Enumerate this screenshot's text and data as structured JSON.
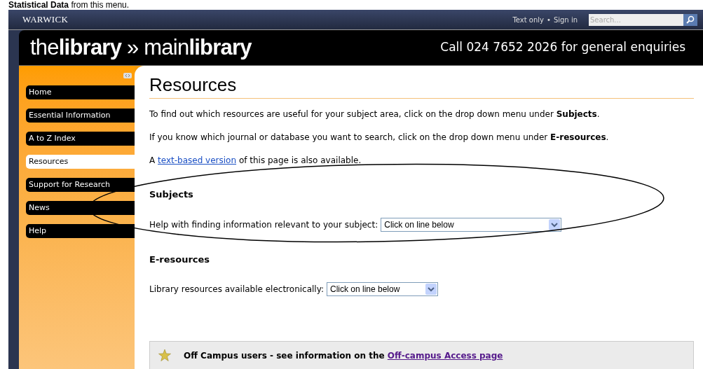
{
  "document_caption": "**Statistical Data** from this menu.",
  "top_bar": {
    "logo": "WARWICK",
    "links": [
      "Text only",
      "Sign in"
    ],
    "separator": "•",
    "search": {
      "placeholder": "Search..."
    }
  },
  "banner": {
    "title": "the**library** » main**library**",
    "phone": "Call 024 7652 2026 for general enquiries"
  },
  "sidebar": {
    "items": [
      {
        "label": "Home",
        "selected": false
      },
      {
        "label": "Essential Information",
        "selected": false
      },
      {
        "label": "A to Z Index",
        "selected": false
      },
      {
        "label": "Resources",
        "selected": true
      },
      {
        "label": "Support for Research",
        "selected": false
      },
      {
        "label": "News",
        "selected": false
      },
      {
        "label": "Help",
        "selected": false
      }
    ]
  },
  "main": {
    "heading": "Resources",
    "paragraphs": [
      "To find out which resources are useful for your subject area, click on the drop down menu under **Subjects**.",
      "If you know which journal or database you want to search, click on the drop down menu under **E-resources**."
    ],
    "text_version": {
      "before": "A",
      "link": "text-based version",
      "after": "of this page is also available."
    },
    "sections": [
      {
        "title": "Subjects",
        "label": "Help with finding information relevant to your subject:",
        "select_value": "Click on line below",
        "wide": true,
        "circled": true
      },
      {
        "title": "E-resources",
        "label": "Library resources available electronically:",
        "select_value": "Click on line below",
        "wide": false,
        "circled": false
      }
    ],
    "notice": {
      "text": "Off Campus users - see information on the",
      "link": "Off-campus Access page"
    }
  }
}
